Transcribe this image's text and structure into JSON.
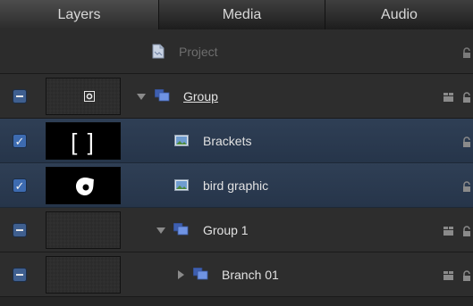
{
  "tabs": [
    {
      "label": "Layers",
      "active": true
    },
    {
      "label": "Media",
      "active": false
    },
    {
      "label": "Audio",
      "active": false
    }
  ],
  "project": {
    "label": "Project"
  },
  "rows": [
    {
      "label": "Group",
      "type": "group",
      "state": "mixed",
      "expanded": true
    },
    {
      "label": "Brackets",
      "type": "image",
      "state": "checked",
      "selected": true
    },
    {
      "label": "bird graphic",
      "type": "image",
      "state": "checked",
      "selected": true
    },
    {
      "label": "Group 1",
      "type": "group",
      "state": "mixed",
      "expanded": true
    },
    {
      "label": "Branch 01",
      "type": "group",
      "state": "mixed",
      "expanded": false
    }
  ],
  "thumb_glyphs": {
    "brackets": "[ ]"
  },
  "colors": {
    "selected_row": "#2c3b50",
    "checkbox": "#3d6bb0",
    "background": "#2d2d2d"
  }
}
